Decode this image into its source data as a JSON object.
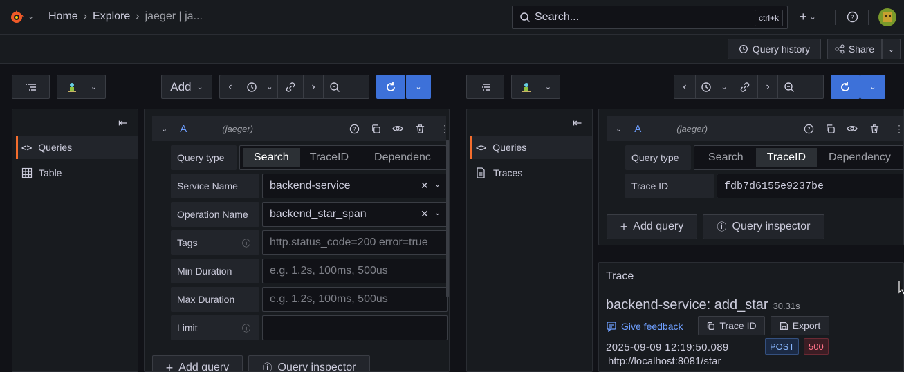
{
  "topbar": {
    "breadcrumb": [
      "Home",
      "Explore",
      "jaeger | ja..."
    ],
    "search_placeholder": "Search...",
    "search_shortcut": "ctrl+k",
    "plus_label": "+",
    "help_icon": "help-circle-icon"
  },
  "subbar": {
    "query_history": "Query history",
    "share": "Share"
  },
  "left_pane": {
    "add_label": "Add",
    "sidebar": [
      {
        "label": "Queries",
        "icon": "code-icon",
        "active": true
      },
      {
        "label": "Table",
        "icon": "table-icon",
        "active": false
      }
    ],
    "query": {
      "ref": "A",
      "datasource": "(jaeger)",
      "query_type_label": "Query type",
      "query_types": [
        "Search",
        "TraceID",
        "Dependenc"
      ],
      "selected_type": "Search",
      "fields": [
        {
          "label": "Service Name",
          "value": "backend-service",
          "placeholder": ""
        },
        {
          "label": "Operation Name",
          "value": "backend_star_span",
          "placeholder": ""
        },
        {
          "label": "Tags",
          "value": "",
          "placeholder": "http.status_code=200 error=true"
        },
        {
          "label": "Min Duration",
          "value": "",
          "placeholder": "e.g. 1.2s, 100ms, 500us"
        },
        {
          "label": "Max Duration",
          "value": "",
          "placeholder": "e.g. 1.2s, 100ms, 500us"
        },
        {
          "label": "Limit",
          "value": "",
          "placeholder": ""
        }
      ],
      "add_query": "Add query",
      "query_inspector": "Query inspector"
    }
  },
  "right_pane": {
    "sidebar": [
      {
        "label": "Queries",
        "icon": "code-icon",
        "active": true
      },
      {
        "label": "Traces",
        "icon": "document-icon",
        "active": false
      }
    ],
    "query": {
      "ref": "A",
      "datasource": "(jaeger)",
      "query_type_label": "Query type",
      "query_types": [
        "Search",
        "TraceID",
        "Dependency"
      ],
      "selected_type": "TraceID",
      "trace_id_label": "Trace ID",
      "trace_id_value": "fdb7d6155e9237be",
      "add_query": "Add query",
      "query_inspector": "Query inspector"
    },
    "trace": {
      "panel_title": "Trace",
      "title": "backend-service: add_star",
      "duration": "30.31s",
      "give_feedback": "Give feedback",
      "trace_id_button": "Trace ID",
      "export_button": "Export",
      "timestamp": "2025-09-09 12:19:50.089",
      "method": "POST",
      "status": "500",
      "url": "http://localhost:8081/star"
    }
  },
  "colors": {
    "accent": "#3d71d9",
    "link": "#6e9fff",
    "active_marker": "#f46d2d",
    "error_text": "#ff7389",
    "post_text": "#8ab8ff"
  }
}
